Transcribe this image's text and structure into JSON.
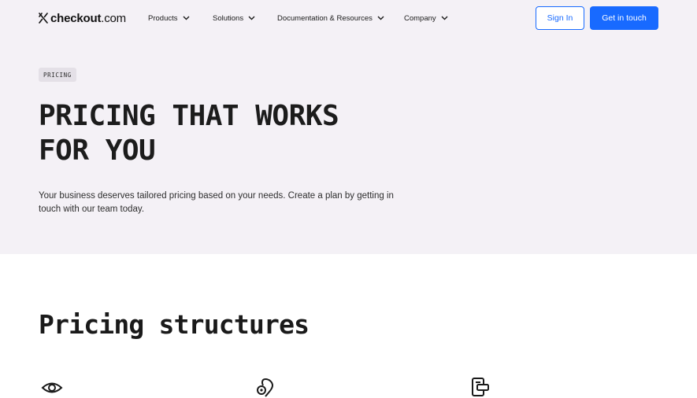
{
  "brand": {
    "name_bold": "checkout",
    "name_suffix": ".com",
    "logo_icon": "checkout-x-icon"
  },
  "nav": {
    "items": [
      {
        "label": "Products",
        "icon": "chevron-down-icon"
      },
      {
        "label": "Solutions",
        "icon": "chevron-down-icon"
      },
      {
        "label": "Documentation & Resources",
        "icon": "chevron-down-icon"
      },
      {
        "label": "Company",
        "icon": "chevron-down-icon"
      }
    ],
    "sign_in_label": "Sign In",
    "get_in_touch_label": "Get in touch"
  },
  "hero": {
    "eyebrow": "PRICING",
    "title_line1": "PRICING THAT WORKS",
    "title_line2": "FOR YOU",
    "description": "Your business deserves tailored pricing based on your needs. Create a plan by getting in touch with our team today."
  },
  "pricing_structures": {
    "title": "Pricing structures",
    "feature_icons": [
      "eye-icon",
      "location-pin-icon",
      "document-icon"
    ]
  },
  "colors": {
    "accent": "#186aff",
    "hero_bg": "#f4f1f6",
    "eyebrow_bg": "#e4e0e7"
  }
}
